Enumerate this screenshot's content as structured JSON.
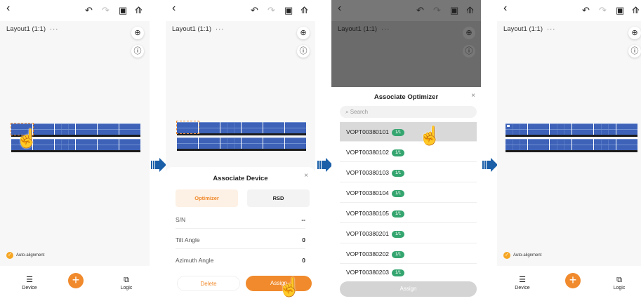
{
  "common": {
    "layout_title": "Layout1 (1:1)",
    "more": "···",
    "auto_alignment": "Auto-alignment",
    "nav_device": "Device",
    "nav_logic": "Logic",
    "plus": "+",
    "icons": {
      "back": "back-chevron-icon",
      "undo": "undo-icon",
      "redo": "redo-icon",
      "save": "save-icon",
      "export": "export-icon",
      "locate": "locate-icon",
      "info": "info-icon"
    },
    "glyphs": {
      "back": "‹",
      "undo": "↶",
      "redo": "↷",
      "save": "▣",
      "export": "⟰",
      "locate": "⊕",
      "info": "ⓘ",
      "check": "✓",
      "device": "☰",
      "logic": "⧉",
      "hand": "☝",
      "close": "×",
      "search": "⌕"
    },
    "accent": "#f08a2c"
  },
  "associate_device": {
    "title": "Associate Device",
    "close": "×",
    "tab_optimizer": "Optimizer",
    "tab_rsd": "RSD",
    "fields": [
      {
        "label": "S/N",
        "value": "--"
      },
      {
        "label": "Tilt Angle",
        "value": "0"
      },
      {
        "label": "Azimuth Angle",
        "value": "0"
      }
    ],
    "delete_label": "Delete",
    "assign_label": "Assign"
  },
  "associate_optimizer": {
    "title": "Associate Optimizer",
    "close": "×",
    "search_placeholder": "Search",
    "items": [
      {
        "sn": "VOPT00380101",
        "badge": "1/1"
      },
      {
        "sn": "VOPT00380102",
        "badge": "1/1"
      },
      {
        "sn": "VOPT00380103",
        "badge": "1/1"
      },
      {
        "sn": "VOPT00380104",
        "badge": "1/1"
      },
      {
        "sn": "VOPT00380105",
        "badge": "1/1"
      },
      {
        "sn": "VOPT00380201",
        "badge": "1/1"
      },
      {
        "sn": "VOPT00380202",
        "badge": "1/1"
      },
      {
        "sn": "VOPT00380203",
        "badge": "1/1"
      }
    ],
    "assign_label": "Assign"
  },
  "arrow_color": "#1a5fa8"
}
